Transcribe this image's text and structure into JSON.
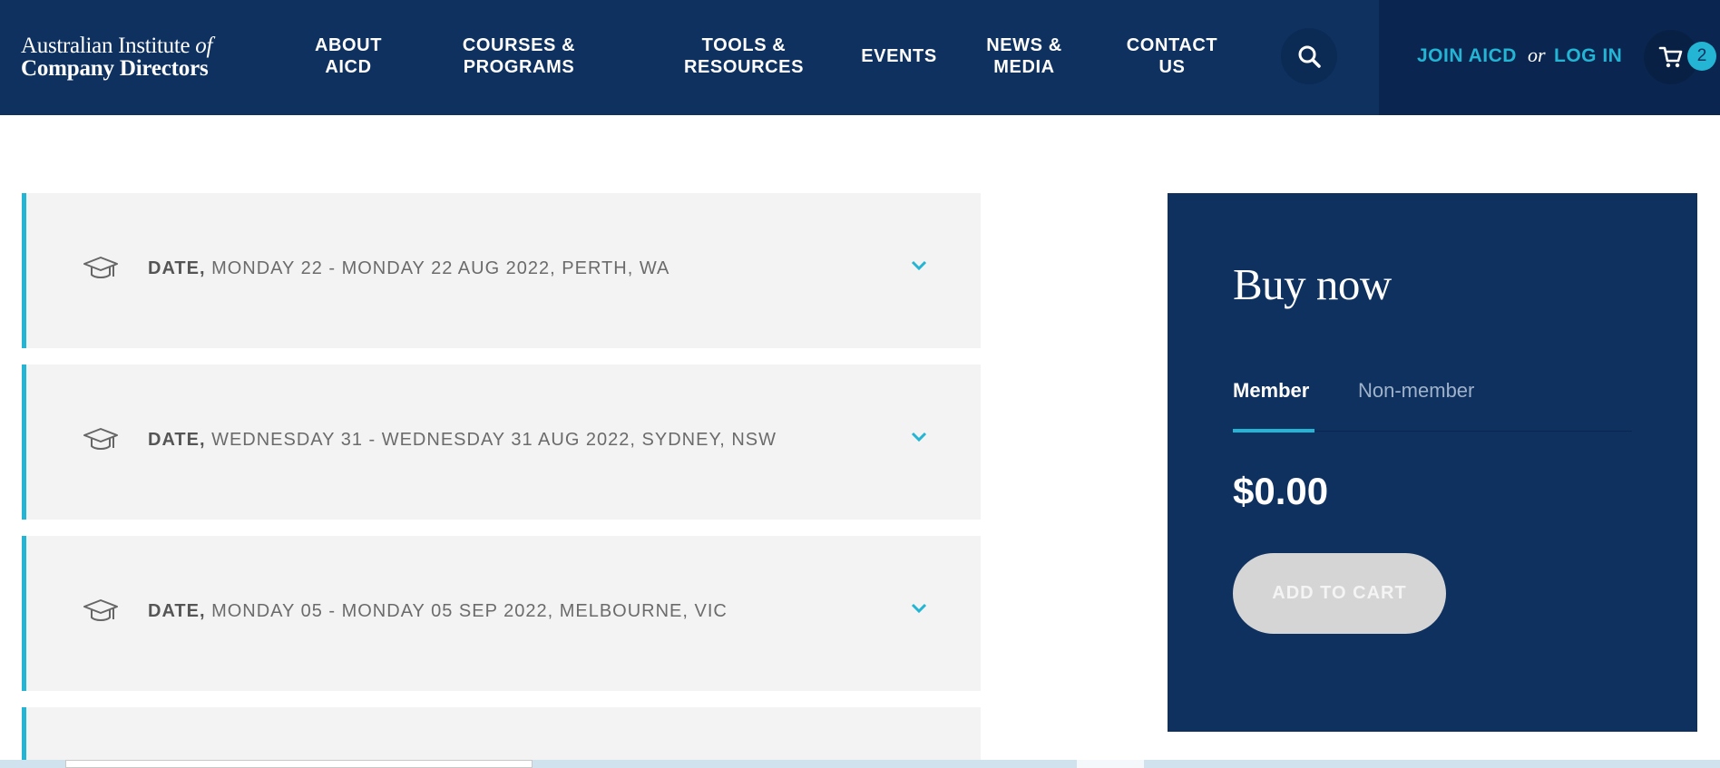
{
  "header": {
    "logo": {
      "line1_main": "Australian Institute ",
      "line1_italic": "of",
      "line2": "Company Directors"
    },
    "nav": [
      {
        "line1": "ABOUT",
        "line2": "AICD"
      },
      {
        "line1": "COURSES &",
        "line2": "PROGRAMS"
      },
      {
        "line1": "TOOLS &",
        "line2": "RESOURCES"
      },
      {
        "line1": "EVENTS",
        "line2": ""
      },
      {
        "line1": "NEWS &",
        "line2": "MEDIA"
      },
      {
        "line1": "CONTACT",
        "line2": "US"
      }
    ],
    "search_icon": "search-icon",
    "join_label": "JOIN AICD",
    "or_label": "or",
    "login_label": "LOG IN",
    "cart_icon": "cart-icon",
    "cart_count": "2"
  },
  "sessions": [
    {
      "label": "DATE,",
      "detail": "MONDAY 22 - MONDAY 22 AUG 2022, PERTH, WA"
    },
    {
      "label": "DATE,",
      "detail": "WEDNESDAY 31 - WEDNESDAY 31 AUG 2022, SYDNEY, NSW"
    },
    {
      "label": "DATE,",
      "detail": "MONDAY 05 - MONDAY 05 SEP 2022, MELBOURNE, VIC"
    }
  ],
  "buy": {
    "title": "Buy now",
    "tabs": [
      "Member",
      "Non-member"
    ],
    "active_tab": "Member",
    "price": "$0.00",
    "add_to_cart_label": "ADD TO CART"
  },
  "colors": {
    "navy": "#0e3160",
    "accent": "#23b5d3",
    "row_bg": "#f3f3f3",
    "disabled_button": "#d5d5d5"
  }
}
